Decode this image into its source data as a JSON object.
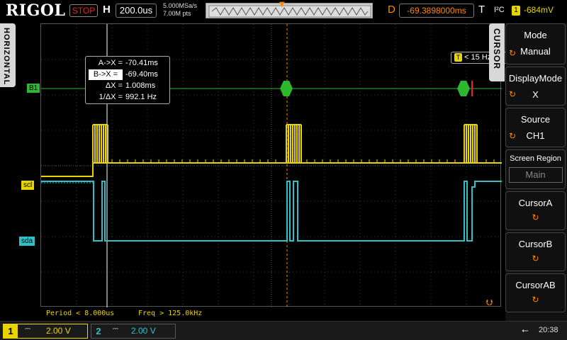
{
  "brand": "RIGOL",
  "status": "STOP",
  "horizontal": {
    "label": "H",
    "timebase": "200.0us",
    "sample_rate": "5.000MSa/s",
    "memory_points": "7.00M pts"
  },
  "delay": {
    "label": "D",
    "value": "-69.3898000ms"
  },
  "trigger": {
    "label": "T",
    "type": "I²C",
    "source": "1",
    "level": "-684mV",
    "freq_source": "T",
    "freq": "< 15 Hz"
  },
  "left_tab": "HORIZONTAL",
  "channel_markers": {
    "b1": "B1",
    "scl": "scl",
    "sda": "sda"
  },
  "cursor_readout": {
    "ax_label": "A->X =",
    "ax_value": "-70.41ms",
    "bx_label": "B->X =",
    "bx_value": "-69.40ms",
    "dx_label": "ΔX =",
    "dx_value": "1.008ms",
    "inv_label": "1/ΔX =",
    "inv_value": "992.1 Hz"
  },
  "decoder_line": {
    "period": "Period < 8.000us",
    "freq": "Freq > 125.0kHz"
  },
  "menu": {
    "tab": "CURSOR",
    "mode": {
      "title": "Mode",
      "value": "Manual"
    },
    "display_mode": {
      "title": "DisplayMode",
      "value": "X"
    },
    "source": {
      "title": "Source",
      "value": "CH1"
    },
    "screen_region": {
      "title": "Screen Region",
      "value": "Main"
    },
    "cursor_a": "CursorA",
    "cursor_b": "CursorB",
    "cursor_ab": "CursorAB"
  },
  "channels": [
    {
      "num": "1",
      "coupling": "⎓",
      "scale": "2.00 V",
      "color": "#e8d400"
    },
    {
      "num": "2",
      "coupling": "⎓",
      "scale": "2.00 V",
      "color": "#2fc0c8"
    }
  ],
  "clock": "20:38",
  "colors": {
    "ch1": "#e8d400",
    "ch2": "#2fc0c8",
    "bus": "#2db82d",
    "accent": "#ff8800",
    "stop": "#ee2222"
  }
}
